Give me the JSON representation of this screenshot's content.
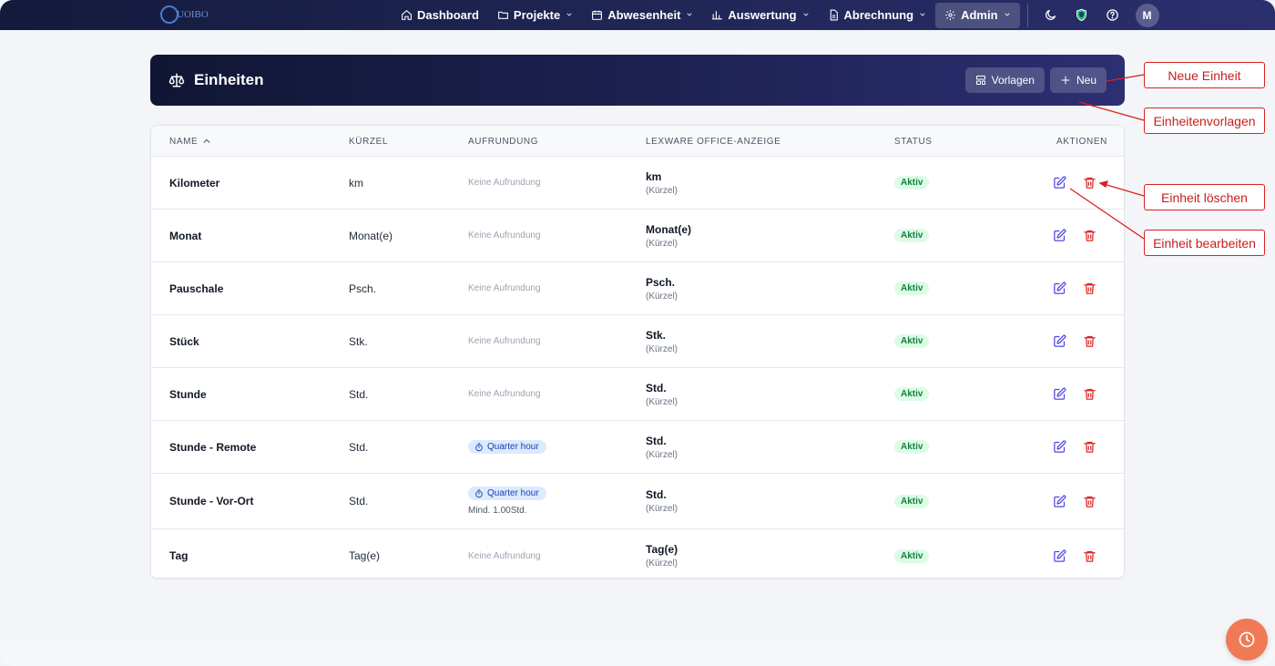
{
  "nav": {
    "logo_text": "UOIBO",
    "items": [
      {
        "label": "Dashboard",
        "icon": "home-icon",
        "has_menu": false
      },
      {
        "label": "Projekte",
        "icon": "folder-icon",
        "has_menu": true
      },
      {
        "label": "Abwesenheit",
        "icon": "calendar-icon",
        "has_menu": true
      },
      {
        "label": "Auswertung",
        "icon": "bar-chart-icon",
        "has_menu": true
      },
      {
        "label": "Abrechnung",
        "icon": "document-icon",
        "has_menu": true
      },
      {
        "label": "Admin",
        "icon": "gear-icon",
        "has_menu": true,
        "active": true
      }
    ],
    "avatar_initial": "M"
  },
  "header": {
    "title": "Einheiten",
    "templates_label": "Vorlagen",
    "new_label": "Neu"
  },
  "table": {
    "columns": [
      "NAME",
      "KÜRZEL",
      "AUFRUNDUNG",
      "LEXWARE OFFICE-ANZEIGE",
      "STATUS",
      "AKTIONEN"
    ],
    "rows": [
      {
        "name": "Kilometer",
        "short": "km",
        "rounding": "Keine Aufrundung",
        "lex": "km",
        "lex_sub": "(Kürzel)",
        "status": "Aktiv"
      },
      {
        "name": "Monat",
        "short": "Monat(e)",
        "rounding": "Keine Aufrundung",
        "lex": "Monat(e)",
        "lex_sub": "(Kürzel)",
        "status": "Aktiv"
      },
      {
        "name": "Pauschale",
        "short": "Psch.",
        "rounding": "Keine Aufrundung",
        "lex": "Psch.",
        "lex_sub": "(Kürzel)",
        "status": "Aktiv"
      },
      {
        "name": "Stück",
        "short": "Stk.",
        "rounding": "Keine Aufrundung",
        "lex": "Stk.",
        "lex_sub": "(Kürzel)",
        "status": "Aktiv"
      },
      {
        "name": "Stunde",
        "short": "Std.",
        "rounding": "Keine Aufrundung",
        "lex": "Std.",
        "lex_sub": "(Kürzel)",
        "status": "Aktiv"
      },
      {
        "name": "Stunde - Remote",
        "short": "Std.",
        "rounding_pill": "Quarter hour",
        "lex": "Std.",
        "lex_sub": "(Kürzel)",
        "status": "Aktiv"
      },
      {
        "name": "Stunde - Vor-Ort",
        "short": "Std.",
        "rounding_pill": "Quarter hour",
        "rounding_min": "Mind. 1.00Std.",
        "lex": "Std.",
        "lex_sub": "(Kürzel)",
        "status": "Aktiv"
      },
      {
        "name": "Tag",
        "short": "Tag(e)",
        "rounding": "Keine Aufrundung",
        "lex": "Tag(e)",
        "lex_sub": "(Kürzel)",
        "status": "Aktiv"
      }
    ]
  },
  "annotations": {
    "new_unit": "Neue Einheit",
    "unit_templates": "Einheitenvorlagen",
    "delete_unit": "Einheit löschen",
    "edit_unit": "Einheit bearbeiten"
  },
  "colors": {
    "accent": "#2b2f6e",
    "status_green": "#15803d",
    "annotation_red": "#d92121",
    "edit_icon": "#4f46e5",
    "delete_icon": "#dc2626",
    "fab": "#f07a55"
  }
}
